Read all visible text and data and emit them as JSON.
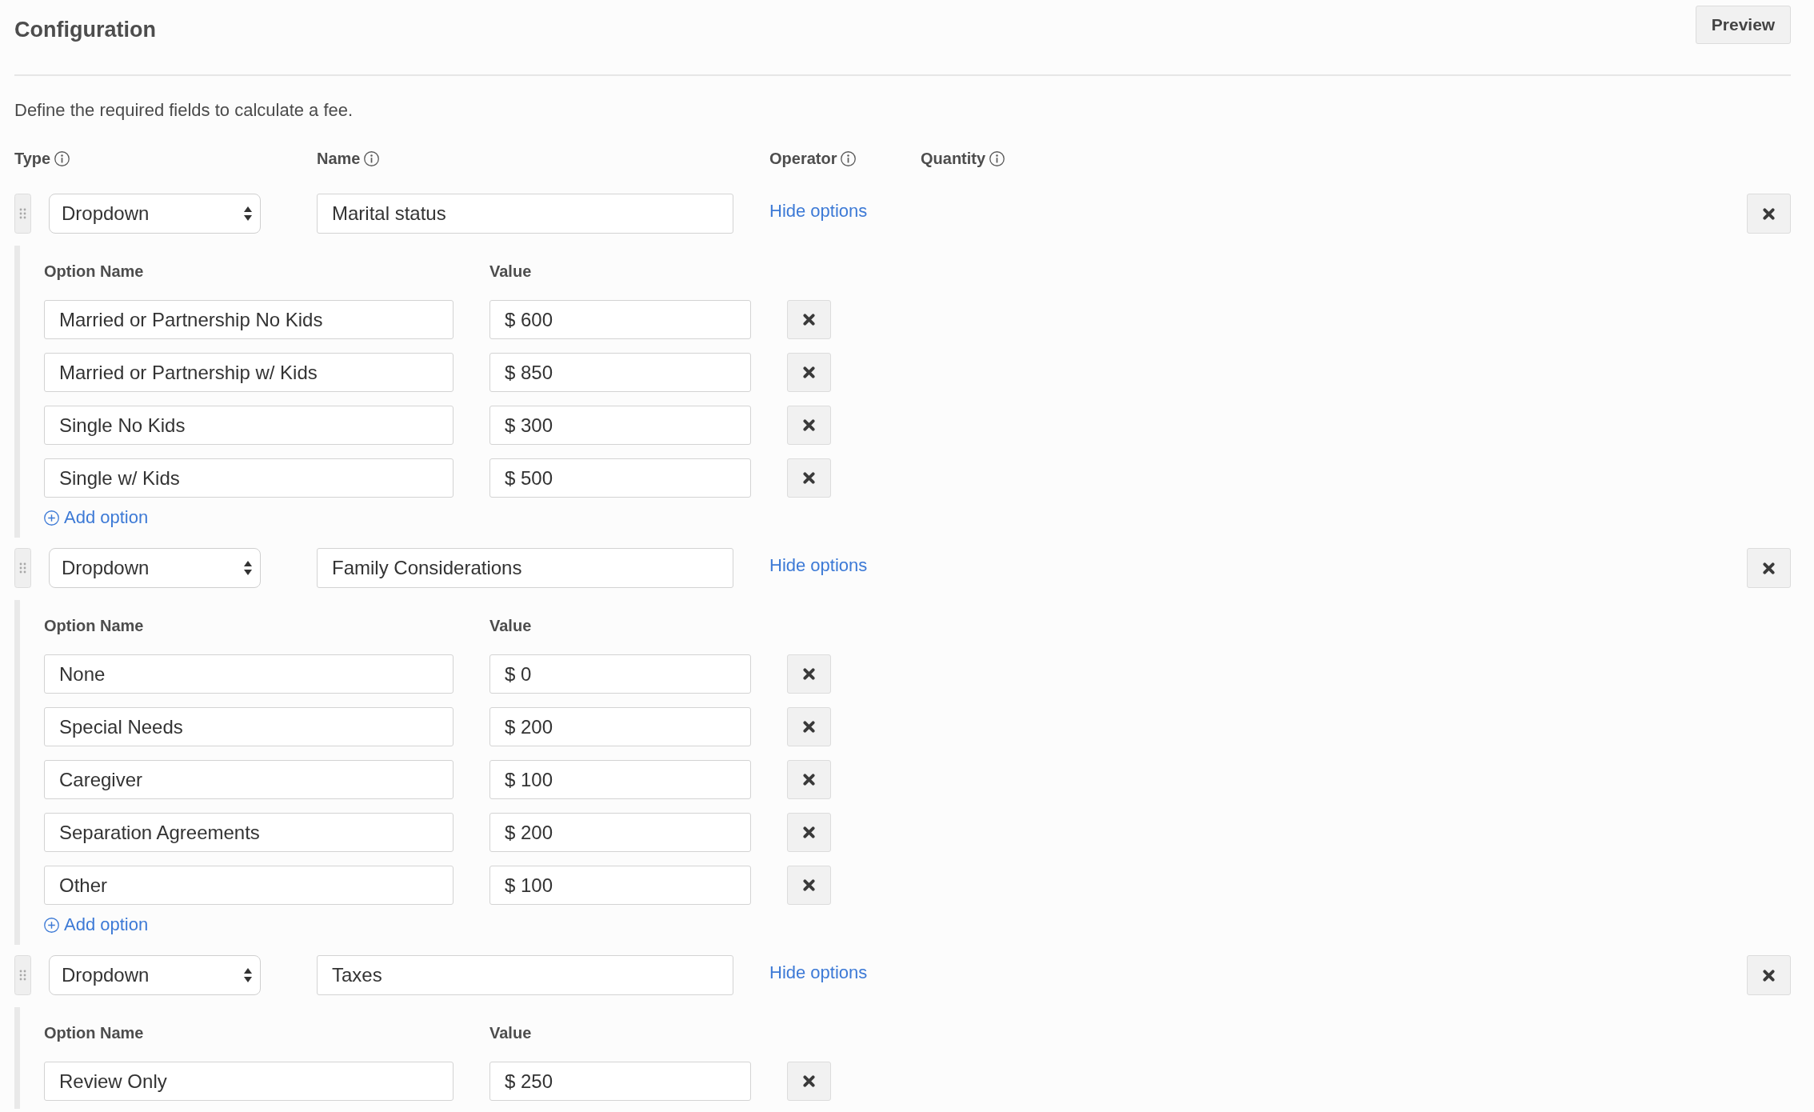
{
  "page": {
    "title": "Configuration",
    "preview_button": "Preview"
  },
  "description": "Define the required fields to calculate a fee.",
  "columns": [
    "Type",
    "Name",
    "Operator",
    "Quantity"
  ],
  "fields": [
    {
      "type": "Dropdown",
      "name": "Marital status",
      "toggle": "Hide options",
      "option_columns": [
        "Option Name",
        "Value"
      ],
      "options": [
        {
          "name": "Married or Partnership No Kids",
          "value": "$ 600"
        },
        {
          "name": "Married or Partnership w/ Kids",
          "value": "$ 850"
        },
        {
          "name": "Single No Kids",
          "value": "$ 300"
        },
        {
          "name": "Single w/ Kids",
          "value": "$ 500"
        }
      ],
      "add_option": "Add option"
    },
    {
      "type": "Dropdown",
      "name": "Family Considerations",
      "toggle": "Hide options",
      "option_columns": [
        "Option Name",
        "Value"
      ],
      "options": [
        {
          "name": "None",
          "value": "$ 0"
        },
        {
          "name": "Special Needs",
          "value": "$ 200"
        },
        {
          "name": "Caregiver",
          "value": "$ 100"
        },
        {
          "name": "Separation Agreements",
          "value": "$ 200"
        },
        {
          "name": "Other",
          "value": "$ 100"
        }
      ],
      "add_option": "Add option"
    },
    {
      "type": "Dropdown",
      "name": "Taxes",
      "toggle": "Hide options",
      "option_columns": [
        "Option Name",
        "Value"
      ],
      "options": [
        {
          "name": "Review Only",
          "value": "$ 250"
        }
      ]
    }
  ]
}
